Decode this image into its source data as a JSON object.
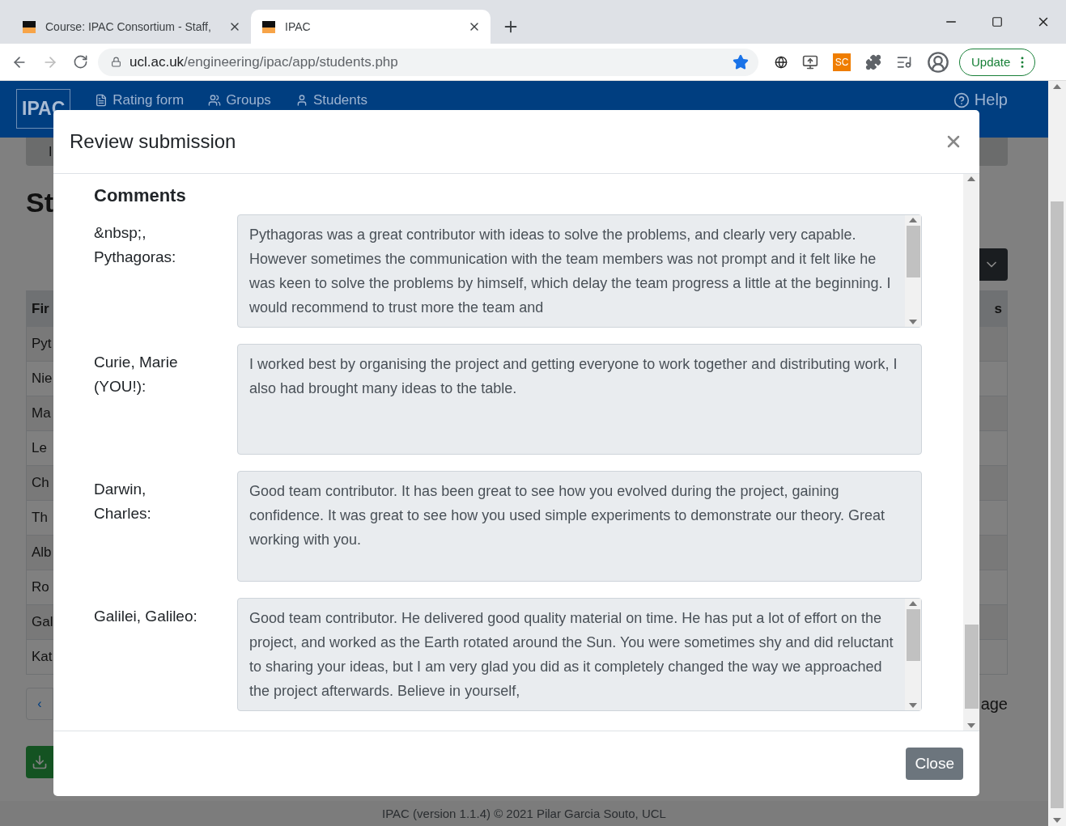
{
  "browser": {
    "tabs": [
      {
        "title": "Course: IPAC Consortium - Staff,",
        "selected": false
      },
      {
        "title": "IPAC",
        "selected": true
      }
    ],
    "url": {
      "host": "ucl.ac.uk",
      "path": "/engineering/ipac/app/students.php"
    },
    "bookmarked": true,
    "extension_badge": "SC",
    "update_button": "Update"
  },
  "navbar": {
    "brand": "IPAC",
    "items": [
      {
        "label": "Rating form"
      },
      {
        "label": "Groups"
      },
      {
        "label": "Students"
      }
    ],
    "help": "Help"
  },
  "page": {
    "alert_text": "I",
    "heading": "St",
    "table": {
      "header_left": "Fir",
      "header_right": "s",
      "rows": [
        "Pyt",
        "Nie",
        "Ma",
        "Le",
        "Ch",
        "Th",
        "Alb",
        "Ro",
        "Gal",
        "Kat"
      ]
    },
    "pagination_prev": "‹",
    "pagination_tail": "age"
  },
  "modal": {
    "title": "Review submission",
    "section": "Comments",
    "comments": [
      {
        "author": "&nbsp;,\nPythagoras:",
        "text": "Pythagoras was a great contributor with ideas to solve the problems, and clearly very capable. However sometimes the communication with the team members was not prompt and it felt like he was keen to solve the problems by himself, which delay the team progress a little at the beginning. I would recommend to trust more the team and",
        "scrollable": true
      },
      {
        "author": "Curie, Marie\n(YOU!):",
        "text": "I worked best by organising the project and getting everyone to work together and distributing work, I also had brought many ideas to the table.",
        "scrollable": false
      },
      {
        "author": "Darwin,\nCharles:",
        "text": "Good team contributor. It has been great to see how you evolved during the project, gaining confidence. It was great to see how you used simple experiments to demonstrate our theory. Great working with you.",
        "scrollable": false
      },
      {
        "author": "Galilei, Galileo:",
        "text": "Good team contributor. He delivered good quality material on time. He has put a lot of effort on the project, and worked as the Earth rotated around the Sun. You were sometimes shy and did reluctant to sharing your ideas, but I am very glad you did as it completely changed the way we approached the project afterwards. Believe in yourself,",
        "scrollable": true
      }
    ],
    "close_button": "Close"
  },
  "footer": "IPAC (version 1.1.4) © 2021 Pilar Garcia Souto, UCL"
}
